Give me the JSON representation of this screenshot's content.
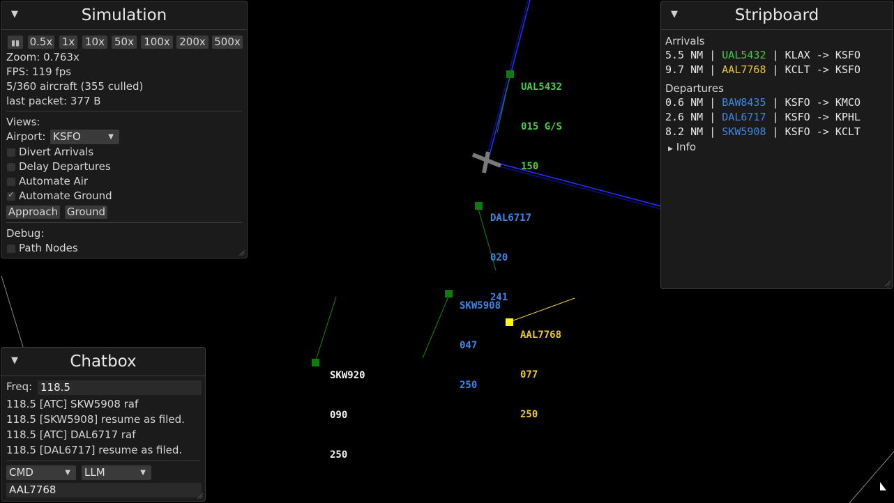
{
  "simulation": {
    "title": "Simulation",
    "speeds": [
      "0.5x",
      "1x",
      "10x",
      "50x",
      "100x",
      "200x",
      "500x"
    ],
    "zoom": "Zoom: 0.763x",
    "fps": "FPS: 119 fps",
    "aircraft": "5/360 aircraft (355 culled)",
    "packet": "last packet: 377 B",
    "views_label": "Views:",
    "airport_label": "Airport:",
    "airport_value": "KSFO",
    "checkboxes": [
      {
        "label": "Divert Arrivals",
        "checked": false
      },
      {
        "label": "Delay Departures",
        "checked": false
      },
      {
        "label": "Automate Air",
        "checked": false
      },
      {
        "label": "Automate Ground",
        "checked": true
      }
    ],
    "approach_button": "Approach",
    "ground_button": "Ground",
    "debug_label": "Debug:",
    "path_nodes": "Path Nodes"
  },
  "stripboard": {
    "title": "Stripboard",
    "arrivals_label": "Arrivals",
    "arrivals": [
      {
        "dist": "5.5 NM | ",
        "callsign": "UAL5432",
        "route": " | KLAX -> KSFO",
        "color": "#4ec94e"
      },
      {
        "dist": "9.7 NM | ",
        "callsign": "AAL7768",
        "route": " | KCLT -> KSFO",
        "color": "#e8c83a"
      }
    ],
    "departures_label": "Departures",
    "departures": [
      {
        "dist": "0.6 NM | ",
        "callsign": "BAW8435",
        "route": " | KSFO -> KMCO",
        "color": "#3f86e3"
      },
      {
        "dist": "2.6 NM | ",
        "callsign": "DAL6717",
        "route": " | KSFO -> KPHL",
        "color": "#3f86e3"
      },
      {
        "dist": "8.2 NM | ",
        "callsign": "SKW5908",
        "route": " | KSFO -> KCLT",
        "color": "#3f86e3"
      }
    ],
    "info_label": "Info"
  },
  "chatbox": {
    "title": "Chatbox",
    "freq_label": "Freq:",
    "freq_value": "118.5",
    "messages": [
      "118.5 [ATC] SKW5908 raf",
      "118.5 [SKW5908] resume as filed.",
      "118.5 [ATC] DAL6717 raf",
      "118.5 [DAL6717] resume as filed."
    ],
    "mode_value": "CMD",
    "engine_value": "LLM",
    "input_value": "AAL7768"
  },
  "aircraft": [
    {
      "callsign": "UAL5432",
      "line2": "015 G/S",
      "line3": "150",
      "color": "#4ec94e"
    },
    {
      "callsign": "DAL6717",
      "line2": "020",
      "line3": "241",
      "color": "#3f86e3"
    },
    {
      "callsign": "SKW5908",
      "line2": "047",
      "line3": "250",
      "color": "#3f86e3"
    },
    {
      "callsign": "AAL7768",
      "line2": "077",
      "line3": "250",
      "color": "#e8c83a"
    },
    {
      "callsign": "SKW920",
      "line2": "090",
      "line3": "250",
      "color": "#f2f2f2"
    }
  ],
  "colors": {
    "arrival": "#4ec94e",
    "departure": "#3f86e3",
    "selected": "#e8c83a",
    "target_green": "#0f7a0f",
    "target_yellow": "#ffff00",
    "runway_blue": "#2233ff"
  }
}
